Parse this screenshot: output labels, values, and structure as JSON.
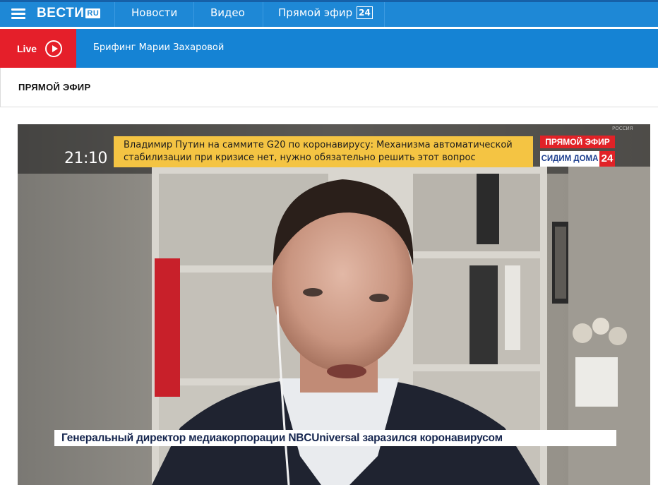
{
  "nav": {
    "logo_main": "ВЕСТИ",
    "logo_suffix": "RU",
    "items": [
      {
        "label": "Новости"
      },
      {
        "label": "Видео"
      },
      {
        "label": "Прямой эфир",
        "badge": "24"
      }
    ]
  },
  "livebar": {
    "live_label": "Live",
    "title": "Брифинг Марии Захаровой"
  },
  "section": {
    "title": "ПРЯМОЙ ЭФИР"
  },
  "player": {
    "clock": "21:10",
    "ticker_line1": "Владимир Путин на саммите G20 по коронавирусу: Механизма автоматической",
    "ticker_line2": "стабилизации при кризисе нет, нужно обязательно решить этот вопрос",
    "onair_label": "ПРЯМОЙ ЭФИР",
    "stayhome_label": "СИДИМ ДОМА",
    "channel_number": "24",
    "channel_watermark": "РОССИЯ",
    "lower_third": "Генеральный директор медиакорпорации NBCUniversal заразился коронавирусом"
  },
  "colors": {
    "nav_bg": "#1e88d6",
    "live_red": "#e51f2a",
    "ticker_yellow": "#f4c443",
    "onair_red": "#e12227",
    "lower_third_text": "#16264f"
  }
}
